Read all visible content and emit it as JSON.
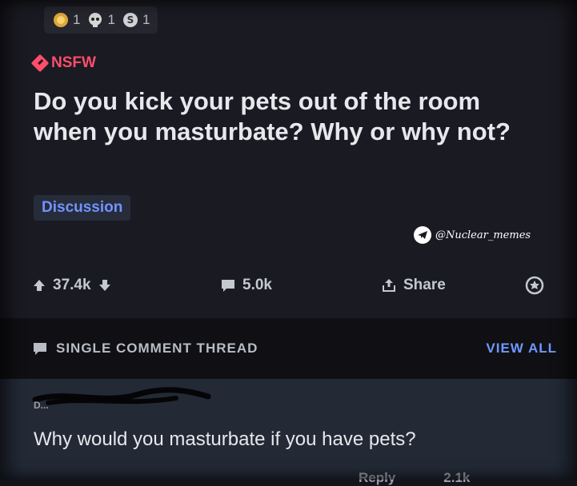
{
  "awards": [
    {
      "icon": "gold-award-icon",
      "count": "1"
    },
    {
      "icon": "skull-award-icon",
      "count": "1"
    },
    {
      "icon": "silver-award-icon",
      "count": "1"
    }
  ],
  "post": {
    "nsfw_tag": "NSFW",
    "title": "Do you kick your pets out of the room when you masturbate? Why or why not?",
    "flair": "Discussion",
    "upvotes": "37.4k",
    "comments": "5.0k",
    "share_label": "Share"
  },
  "watermark": {
    "handle": "@Nuclear_memes",
    "icon": "telegram-icon"
  },
  "thread": {
    "label": "SINGLE COMMENT THREAD",
    "view_all": "VIEW ALL"
  },
  "comment": {
    "username": "D...",
    "text": "Why would you masturbate if you have pets?",
    "reply_label": "Reply",
    "votes": "2.1k"
  },
  "colors": {
    "accent_blue": "#7193ff",
    "nsfw_red": "#ff4d6a",
    "background": "#1a1a22"
  }
}
